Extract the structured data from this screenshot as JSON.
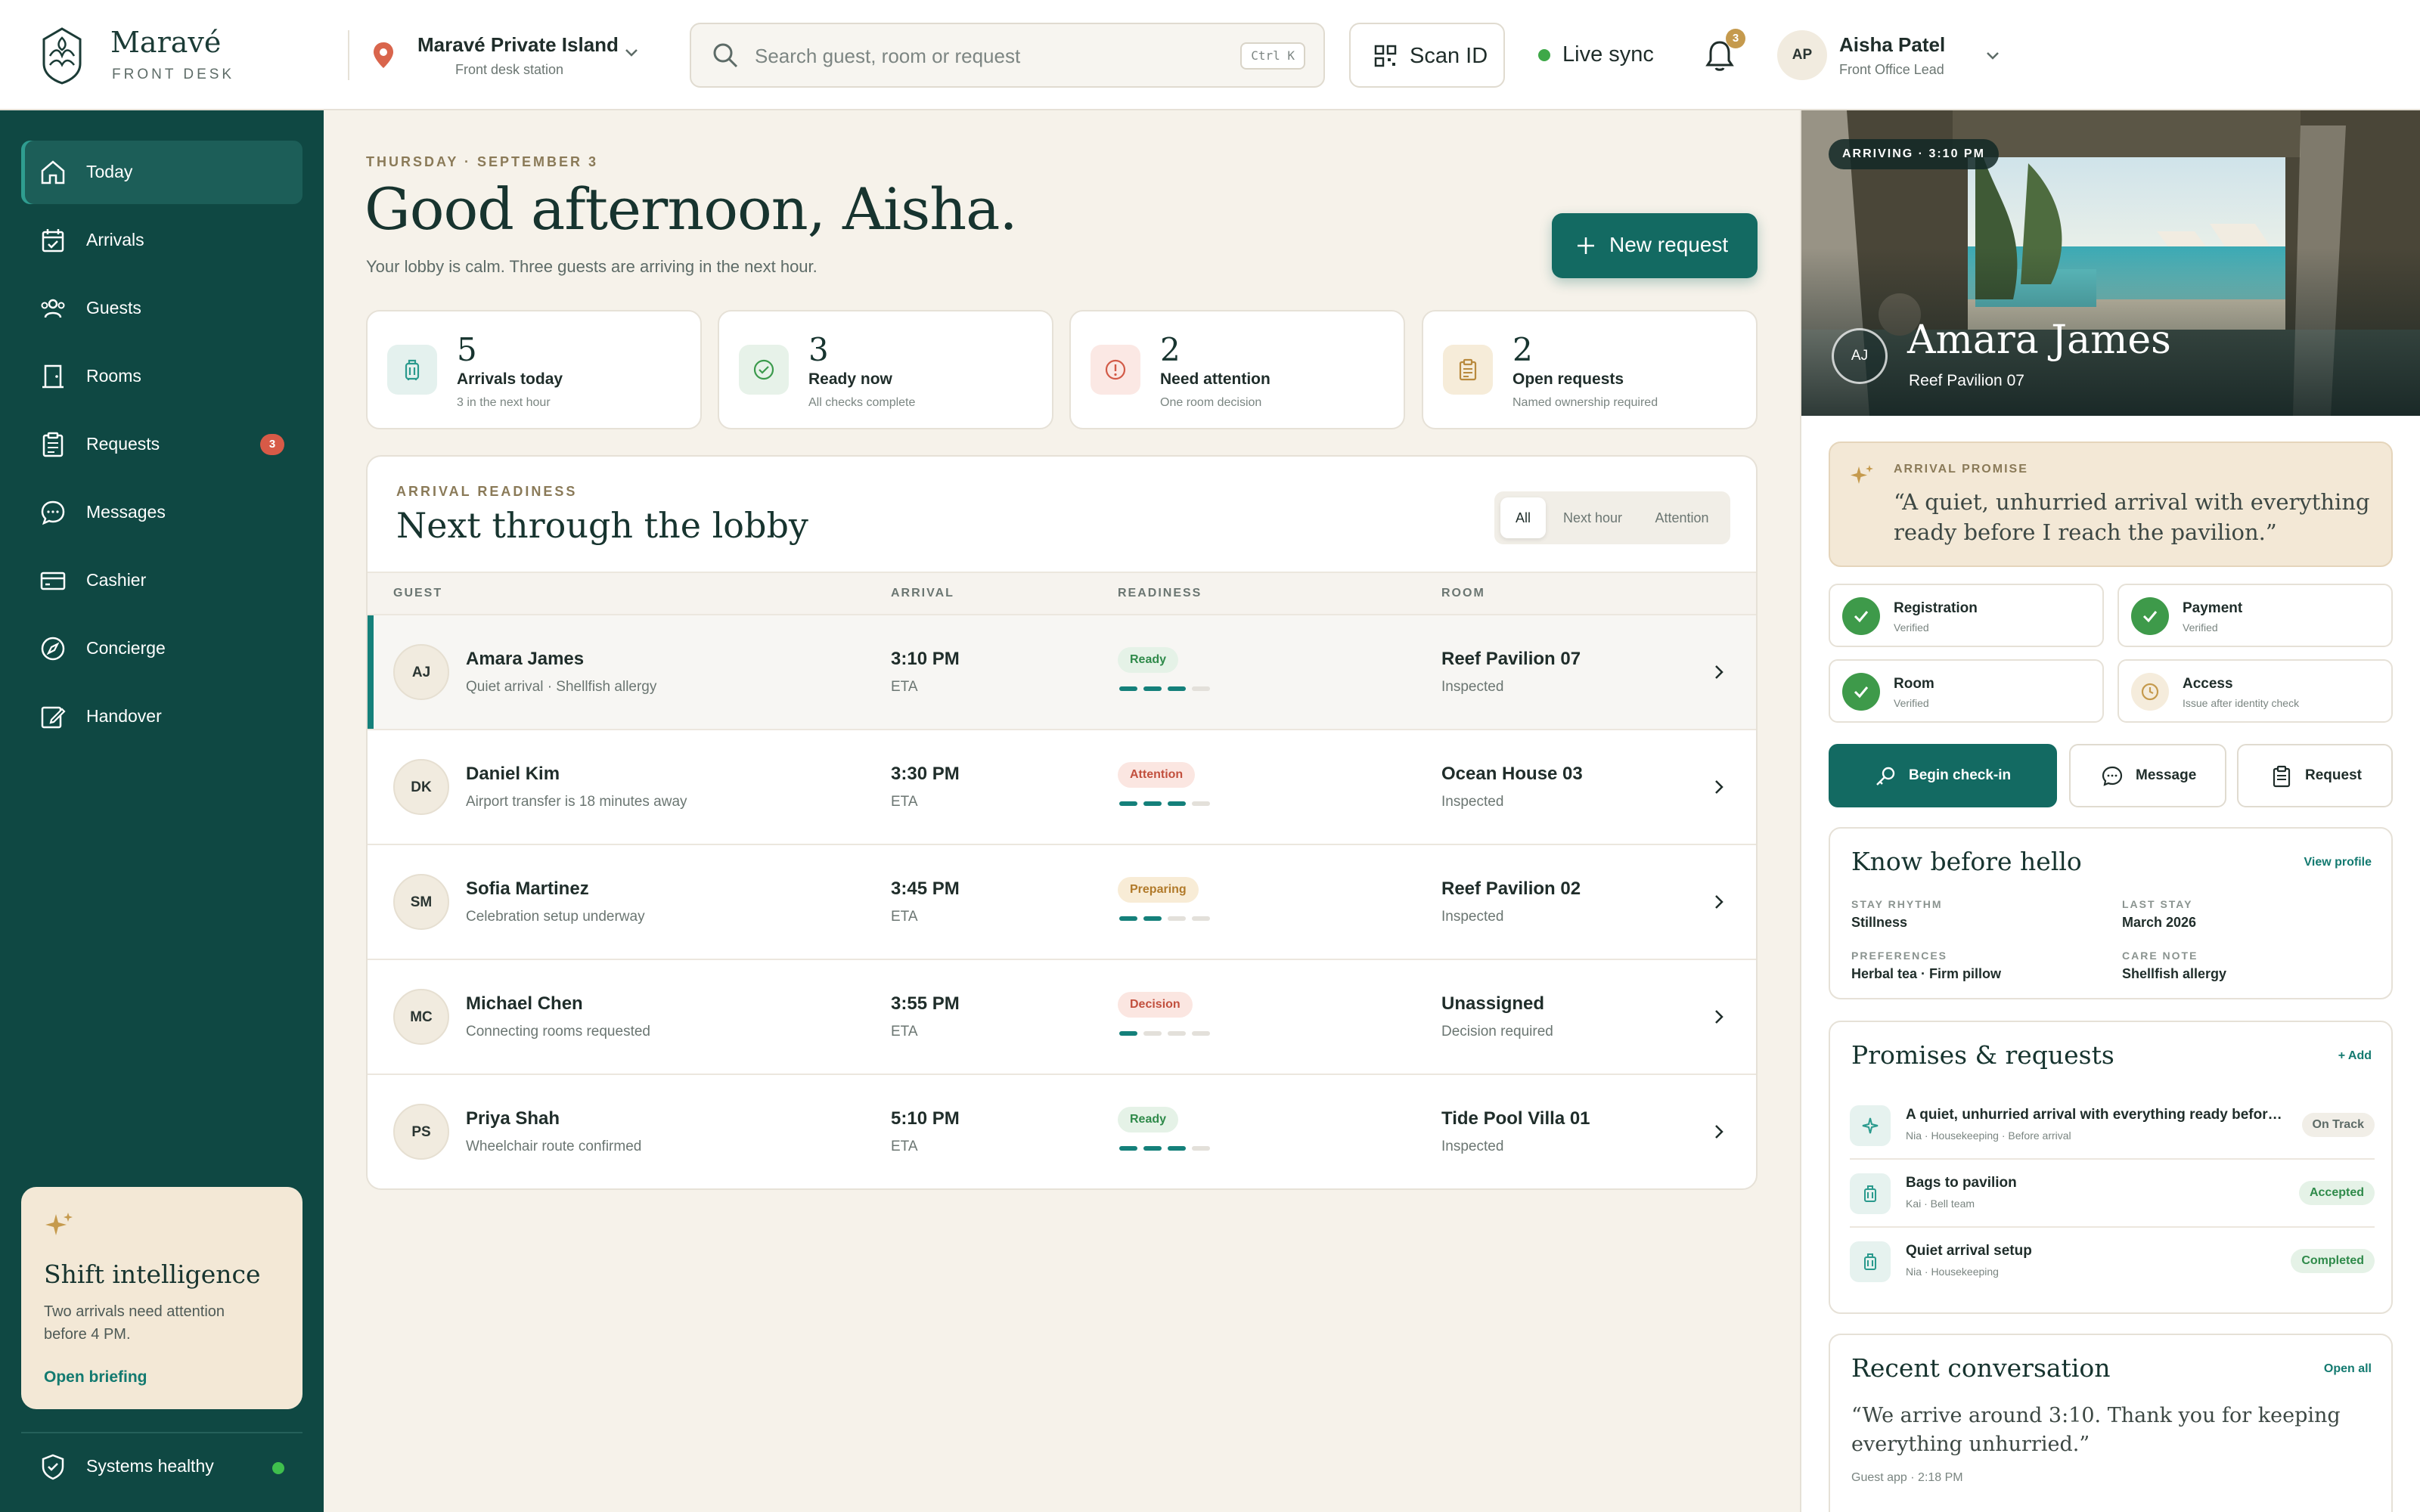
{
  "brand": {
    "name": "Maravé",
    "sub": "FRONT DESK"
  },
  "property": {
    "name": "Maravé Private Island",
    "sub": "Front desk station"
  },
  "search": {
    "placeholder": "Search guest, room or request",
    "shortcut": "Ctrl K"
  },
  "scan_label": "Scan ID",
  "live_sync": "Live sync",
  "notifications": {
    "count": "3"
  },
  "user": {
    "initials": "AP",
    "name": "Aisha Patel",
    "role": "Front Office Lead"
  },
  "sidebar": {
    "items": [
      {
        "label": "Today",
        "icon": "home-icon"
      },
      {
        "label": "Arrivals",
        "icon": "calendar-check-icon"
      },
      {
        "label": "Guests",
        "icon": "users-icon"
      },
      {
        "label": "Rooms",
        "icon": "door-icon"
      },
      {
        "label": "Requests",
        "icon": "clipboard-icon",
        "badge": "3"
      },
      {
        "label": "Messages",
        "icon": "chat-icon"
      },
      {
        "label": "Cashier",
        "icon": "card-icon"
      },
      {
        "label": "Concierge",
        "icon": "compass-icon"
      },
      {
        "label": "Handover",
        "icon": "edit-icon"
      }
    ],
    "shift": {
      "title": "Shift intelligence",
      "body": "Two arrivals need attention before 4 PM.",
      "link": "Open briefing"
    },
    "systems": "Systems healthy"
  },
  "main": {
    "date": "THURSDAY · SEPTEMBER 3",
    "greeting": "Good afternoon, Aisha.",
    "subtitle": "Your lobby is calm. Three guests are arriving in the next hour.",
    "new_request": "New request",
    "stats": [
      {
        "num": "5",
        "label": "Arrivals today",
        "sub": "3 in the next hour",
        "icon": "luggage-icon"
      },
      {
        "num": "3",
        "label": "Ready now",
        "sub": "All checks complete",
        "icon": "check-circle-icon"
      },
      {
        "num": "2",
        "label": "Need attention",
        "sub": "One room decision",
        "icon": "alert-icon"
      },
      {
        "num": "2",
        "label": "Open requests",
        "sub": "Named ownership required",
        "icon": "clipboard-icon"
      }
    ],
    "lobby": {
      "eyebrow": "ARRIVAL READINESS",
      "title": "Next through the lobby",
      "filters": [
        "All",
        "Next hour",
        "Attention"
      ],
      "columns": [
        "GUEST",
        "ARRIVAL",
        "READINESS",
        "ROOM"
      ],
      "rows": [
        {
          "initials": "AJ",
          "name": "Amara James",
          "note": "Quiet arrival · Shellfish allergy",
          "time": "3:10 PM",
          "eta": "ETA",
          "status": "Ready",
          "progress": 3,
          "room": "Reef Pavilion 07",
          "room_status": "Inspected"
        },
        {
          "initials": "DK",
          "name": "Daniel Kim",
          "note": "Airport transfer is 18 minutes away",
          "time": "3:30 PM",
          "eta": "ETA",
          "status": "Attention",
          "progress": 3,
          "room": "Ocean House 03",
          "room_status": "Inspected"
        },
        {
          "initials": "SM",
          "name": "Sofia Martinez",
          "note": "Celebration setup underway",
          "time": "3:45 PM",
          "eta": "ETA",
          "status": "Preparing",
          "progress": 2,
          "room": "Reef Pavilion 02",
          "room_status": "Inspected"
        },
        {
          "initials": "MC",
          "name": "Michael Chen",
          "note": "Connecting rooms requested",
          "time": "3:55 PM",
          "eta": "ETA",
          "status": "Decision",
          "progress": 1,
          "room": "Unassigned",
          "room_status": "Decision required"
        },
        {
          "initials": "PS",
          "name": "Priya Shah",
          "note": "Wheelchair route confirmed",
          "time": "5:10 PM",
          "eta": "ETA",
          "status": "Ready",
          "progress": 3,
          "room": "Tide Pool Villa 01",
          "room_status": "Inspected"
        }
      ]
    }
  },
  "panel": {
    "arriving": "ARRIVING · 3:10 PM",
    "initials": "AJ",
    "name": "Amara James",
    "room": "Reef Pavilion 07",
    "promise": {
      "eyebrow": "ARRIVAL PROMISE",
      "quote": "“A quiet, unhurried arrival with everything ready before I reach the pavilion.”"
    },
    "checks": [
      {
        "title": "Registration",
        "sub": "Verified",
        "state": "done"
      },
      {
        "title": "Payment",
        "sub": "Verified",
        "state": "done"
      },
      {
        "title": "Room",
        "sub": "Verified",
        "state": "done"
      },
      {
        "title": "Access",
        "sub": "Issue after identity check",
        "state": "pending"
      }
    ],
    "actions": {
      "checkin": "Begin check-in",
      "message": "Message",
      "request": "Request"
    },
    "know": {
      "title": "Know before hello",
      "link": "View profile",
      "fields": [
        {
          "label": "STAY RHYTHM",
          "value": "Stillness"
        },
        {
          "label": "LAST STAY",
          "value": "March 2026"
        },
        {
          "label": "PREFERENCES",
          "value": "Herbal tea · Firm pillow"
        },
        {
          "label": "CARE NOTE",
          "value": "Shellfish allergy"
        }
      ]
    },
    "promises": {
      "title": "Promises & requests",
      "link": "+ Add",
      "items": [
        {
          "title": "A quiet, unhurried arrival with everything ready before I reach the pavilion",
          "meta": "Nia · Housekeeping · Before arrival",
          "status": "On Track",
          "icon": "sparkle-icon"
        },
        {
          "title": "Bags to pavilion",
          "meta": "Kai · Bell team",
          "status": "Accepted",
          "icon": "luggage-icon"
        },
        {
          "title": "Quiet arrival setup",
          "meta": "Nia · Housekeeping",
          "status": "Completed",
          "icon": "luggage-icon"
        }
      ]
    },
    "conversation": {
      "title": "Recent conversation",
      "link": "Open all",
      "quote": "“We arrive around 3:10. Thank you for keeping everything unhurried.”",
      "meta": "Guest app · 2:18 PM"
    }
  },
  "colors": {
    "brand": "#0f4843",
    "accent": "#136a62",
    "gold": "#c59a4d",
    "ready": "#2f8a4a",
    "attention": "#c2503e",
    "preparing": "#b17a2a"
  }
}
